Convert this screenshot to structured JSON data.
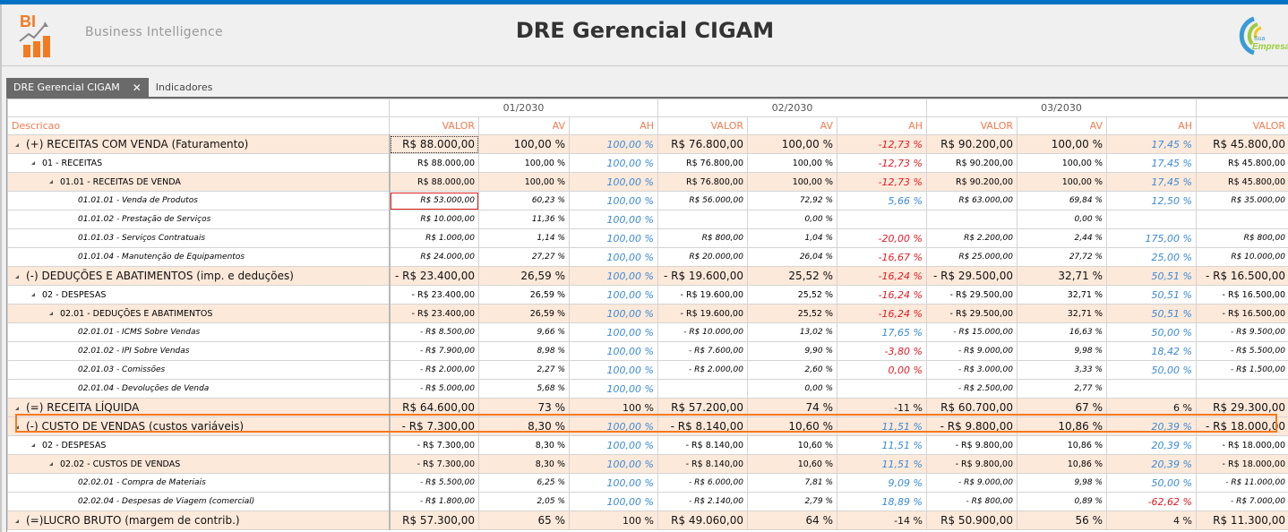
{
  "header": {
    "logo_text": "BI",
    "subtitle": "Business Intelligence",
    "title": "DRE Gerencial CIGAM",
    "company_logo_text": "Sua Empresa"
  },
  "tabs": [
    {
      "label": "DRE Gerencial CIGAM",
      "close": "✕"
    },
    {
      "label": "Indicadores"
    }
  ],
  "columns": {
    "desc": "Descricao",
    "periods": [
      "01/2030",
      "02/2030",
      "03/2030"
    ],
    "sub": [
      "VALOR",
      "AV",
      "AH",
      "VALOR",
      "AV",
      "AH",
      "VALOR",
      "AV",
      "AH",
      "VALOR"
    ]
  },
  "colors": {
    "accent": "#f47a20",
    "topbar": "#0072c6",
    "positive": "#3a8ad8",
    "negative": "#e01b24"
  },
  "rows": [
    {
      "level": 0,
      "desc": "(+) RECEITAS COM VENDA (Faturamento)",
      "cells": [
        "R$ 88.000,00",
        "100,00 %",
        "100,00 %",
        "R$ 76.800,00",
        "100,00 %",
        "-12,73 %",
        "R$ 90.200,00",
        "100,00 %",
        "17,45 %",
        "R$ 45.800,00"
      ]
    },
    {
      "level": 1,
      "desc": "01 - RECEITAS",
      "cells": [
        "R$ 88.000,00",
        "100,00 %",
        "100,00 %",
        "R$ 76.800,00",
        "100,00 %",
        "-12,73 %",
        "R$ 90.200,00",
        "100,00 %",
        "17,45 %",
        "R$ 45.800,00"
      ]
    },
    {
      "level": 2,
      "desc": "01.01 - RECEITAS DE VENDA",
      "cells": [
        "R$ 88.000,00",
        "100,00 %",
        "100,00 %",
        "R$ 76.800,00",
        "100,00 %",
        "-12,73 %",
        "R$ 90.200,00",
        "100,00 %",
        "17,45 %",
        "R$ 45.800,00"
      ]
    },
    {
      "level": 3,
      "desc": "01.01.01 - Venda de Produtos",
      "cells": [
        "R$ 53.000,00",
        "60,23 %",
        "100,00 %",
        "R$ 56.000,00",
        "72,92 %",
        "5,66 %",
        "R$ 63.000,00",
        "69,84 %",
        "12,50 %",
        "R$ 35.000,00"
      ]
    },
    {
      "level": 3,
      "desc": "01.01.02 - Prestação de Serviços",
      "cells": [
        "R$ 10.000,00",
        "11,36 %",
        "100,00 %",
        "",
        "0,00 %",
        "",
        "",
        "0,00 %",
        "",
        ""
      ]
    },
    {
      "level": 3,
      "desc": "01.01.03 - Serviços Contratuais",
      "cells": [
        "R$ 1.000,00",
        "1,14 %",
        "100,00 %",
        "R$ 800,00",
        "1,04 %",
        "-20,00 %",
        "R$ 2.200,00",
        "2,44 %",
        "175,00 %",
        "R$ 800,00"
      ]
    },
    {
      "level": 3,
      "desc": "01.01.04 - Manutenção de Equipamentos",
      "cells": [
        "R$ 24.000,00",
        "27,27 %",
        "100,00 %",
        "R$ 20.000,00",
        "26,04 %",
        "-16,67 %",
        "R$ 25.000,00",
        "27,72 %",
        "25,00 %",
        "R$ 10.000,00"
      ]
    },
    {
      "level": 0,
      "desc": "(-) DEDUÇÕES E ABATIMENTOS (imp. e deduções)",
      "cells": [
        "- R$ 23.400,00",
        "26,59  %",
        "100,00 %",
        "- R$ 19.600,00",
        "25,52  %",
        "-16,24 %",
        "- R$ 29.500,00",
        "32,71  %",
        "50,51 %",
        "- R$ 16.500,00"
      ]
    },
    {
      "level": 1,
      "desc": "02 - DESPESAS",
      "cells": [
        "- R$ 23.400,00",
        "26,59  %",
        "100,00 %",
        "- R$ 19.600,00",
        "25,52  %",
        "-16,24 %",
        "- R$ 29.500,00",
        "32,71  %",
        "50,51 %",
        "- R$ 16.500,00"
      ]
    },
    {
      "level": 2,
      "desc": "02.01 - DEDUÇÕES E ABATIMENTOS",
      "cells": [
        "- R$ 23.400,00",
        "26,59  %",
        "100,00 %",
        "- R$ 19.600,00",
        "25,52  %",
        "-16,24 %",
        "- R$ 29.500,00",
        "32,71  %",
        "50,51 %",
        "- R$ 16.500,00"
      ]
    },
    {
      "level": 3,
      "desc": "02.01.01 - ICMS Sobre Vendas",
      "cells": [
        "- R$ 8.500,00",
        "9,66  %",
        "100,00 %",
        "- R$ 10.000,00",
        "13,02  %",
        "17,65 %",
        "- R$ 15.000,00",
        "16,63  %",
        "50,00 %",
        "- R$ 9.500,00"
      ]
    },
    {
      "level": 3,
      "desc": "02.01.02 - IPI Sobre Vendas",
      "cells": [
        "- R$ 7.900,00",
        "8,98  %",
        "100,00 %",
        "- R$ 7.600,00",
        "9,90  %",
        "-3,80 %",
        "- R$ 9.000,00",
        "9,98  %",
        "18,42 %",
        "- R$ 5.500,00"
      ]
    },
    {
      "level": 3,
      "desc": "02.01.03 - Comissões",
      "cells": [
        "- R$ 2.000,00",
        "2,27  %",
        "100,00 %",
        "- R$ 2.000,00",
        "2,60  %",
        "0,00 %",
        "- R$ 3.000,00",
        "3,33  %",
        "50,00 %",
        "- R$ 1.500,00"
      ]
    },
    {
      "level": 3,
      "desc": "02.01.04 - Devoluções de Venda",
      "cells": [
        "- R$ 5.000,00",
        "5,68  %",
        "100,00 %",
        "",
        "0,00  %",
        "",
        "- R$ 2.500,00",
        "2,77  %",
        "",
        ""
      ]
    },
    {
      "level": 0,
      "total": true,
      "desc": "(=) RECEITA LÍQUIDA",
      "cells": [
        "R$ 64.600,00",
        "73 %",
        "100 %",
        "R$ 57.200,00",
        "74 %",
        "-11 %",
        "R$ 60.700,00",
        "67 %",
        "6 %",
        "R$ 29.300,00"
      ]
    },
    {
      "level": 0,
      "desc": "(-) CUSTO DE VENDAS (custos variáveis)",
      "cells": [
        "- R$ 7.300,00",
        "8,30  %",
        "100,00 %",
        "- R$ 8.140,00",
        "10,60  %",
        "11,51 %",
        "- R$ 9.800,00",
        "10,86  %",
        "20,39 %",
        "- R$ 18.000,00"
      ]
    },
    {
      "level": 1,
      "desc": "02 - DESPESAS",
      "cells": [
        "- R$ 7.300,00",
        "8,30  %",
        "100,00 %",
        "- R$ 8.140,00",
        "10,60  %",
        "11,51 %",
        "- R$ 9.800,00",
        "10,86  %",
        "20,39 %",
        "- R$ 18.000,00"
      ]
    },
    {
      "level": 2,
      "desc": "02.02 - CUSTOS DE VENDAS",
      "cells": [
        "- R$ 7.300,00",
        "8,30  %",
        "100,00 %",
        "- R$ 8.140,00",
        "10,60  %",
        "11,51 %",
        "- R$ 9.800,00",
        "10,86  %",
        "20,39 %",
        "- R$ 18.000,00"
      ]
    },
    {
      "level": 3,
      "desc": "02.02.01 - Compra de Materiais",
      "cells": [
        "- R$ 5.500,00",
        "6,25  %",
        "100,00 %",
        "- R$ 6.000,00",
        "7,81  %",
        "9,09 %",
        "- R$ 9.000,00",
        "9,98  %",
        "50,00 %",
        "- R$ 11.000,00"
      ]
    },
    {
      "level": 3,
      "desc": "02.02.04 - Despesas de Viagem (comercial)",
      "cells": [
        "- R$ 1.800,00",
        "2,05  %",
        "100,00 %",
        "- R$ 2.140,00",
        "2,79  %",
        "18,89 %",
        "- R$ 800,00",
        "0,89  %",
        "-62,62 %",
        "- R$ 7.000,00"
      ]
    },
    {
      "level": 0,
      "total": true,
      "desc": "(=)LUCRO BRUTO (margem de contrib.)",
      "cells": [
        "R$ 57.300,00",
        "65 %",
        "100 %",
        "R$ 49.060,00",
        "64 %",
        "-14 %",
        "R$ 50.900,00",
        "56 %",
        "4 %",
        "R$ 11.300,00"
      ]
    }
  ]
}
